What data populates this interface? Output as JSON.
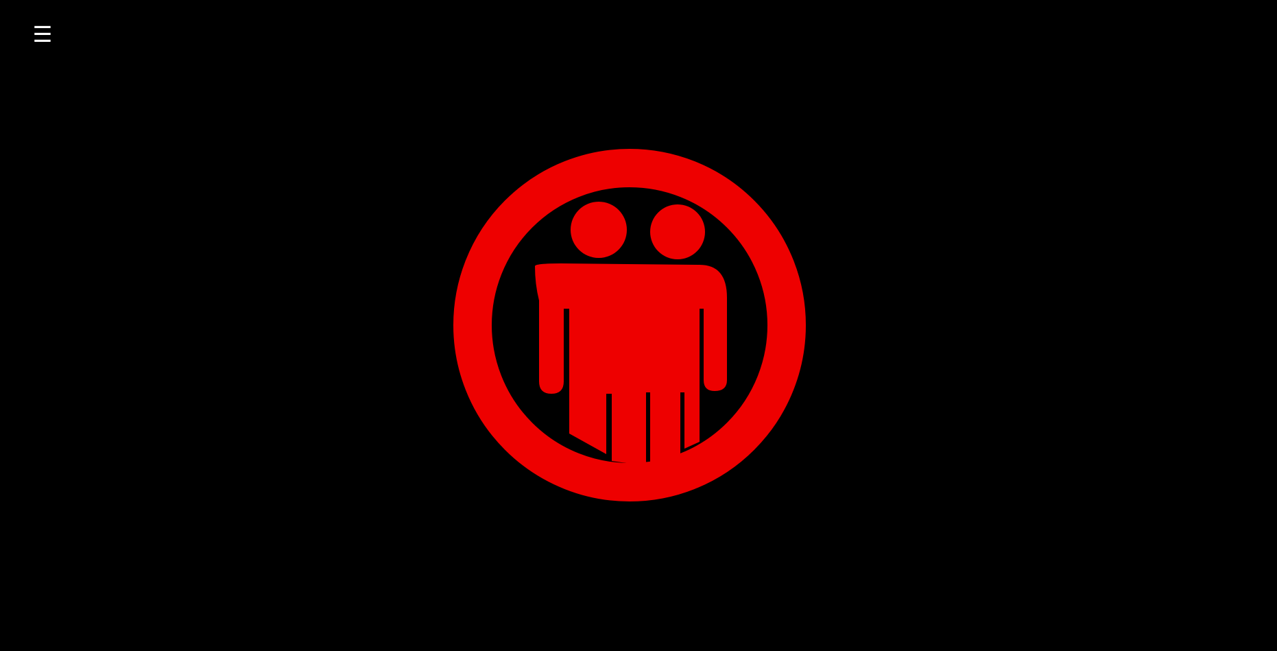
{
  "header": {
    "menu_glyph": "☰"
  },
  "logo": {
    "icon": "two-people-in-circle-icon",
    "color": "#ee0000",
    "background": "#000000"
  }
}
